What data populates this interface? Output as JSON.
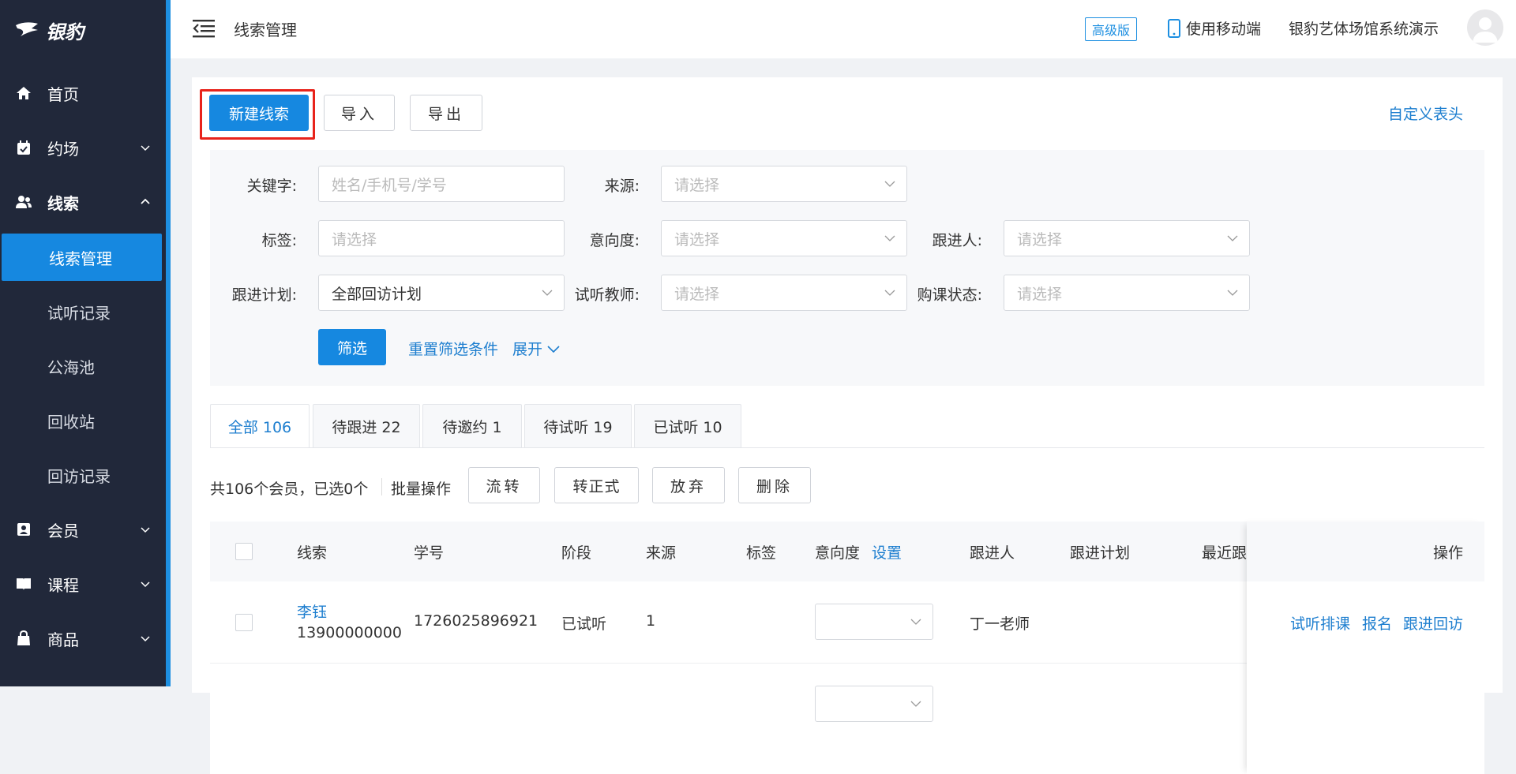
{
  "sidebar": {
    "logo_text": "银豹",
    "items": [
      {
        "label": "首页",
        "icon": "home-icon"
      },
      {
        "label": "约场",
        "icon": "calendar-check-icon"
      },
      {
        "label": "线索",
        "icon": "users-icon"
      },
      {
        "label": "会员",
        "icon": "member-card-icon"
      },
      {
        "label": "课程",
        "icon": "book-icon"
      },
      {
        "label": "商品",
        "icon": "bag-icon"
      }
    ],
    "sub_items": [
      "线索管理",
      "试听记录",
      "公海池",
      "回收站",
      "回访记录"
    ]
  },
  "topbar": {
    "breadcrumb": "线索管理",
    "edition_badge": "高级版",
    "mobile_label": "使用移动端",
    "org_name": "银豹艺体场馆系统演示"
  },
  "toolbar": {
    "new_lead": "新建线索",
    "import": "导入",
    "export": "导出",
    "custom_header": "自定义表头"
  },
  "filters": {
    "keyword_label": "关键字:",
    "keyword_placeholder": "姓名/手机号/学号",
    "source_label": "来源:",
    "tag_label": "标签:",
    "intent_label": "意向度:",
    "follower_label": "跟进人:",
    "plan_label": "跟进计划:",
    "plan_value": "全部回访计划",
    "teacher_label": "试听教师:",
    "purchase_label": "购课状态:",
    "select_placeholder": "请选择",
    "filter_button": "筛选",
    "reset_link": "重置筛选条件",
    "expand_link": "展开"
  },
  "tabs": [
    {
      "label": "全部 106"
    },
    {
      "label": "待跟进 22"
    },
    {
      "label": "待邀约 1"
    },
    {
      "label": "待试听 19"
    },
    {
      "label": "已试听 10"
    }
  ],
  "batch": {
    "summary": "共106个会员，已选0个",
    "label": "批量操作",
    "transfer": "流转",
    "to_formal": "转正式",
    "abandon": "放弃",
    "delete": "删除"
  },
  "table": {
    "headers": {
      "lead": "线索",
      "student_no": "学号",
      "stage": "阶段",
      "source": "来源",
      "tag": "标签",
      "intent": "意向度",
      "intent_setting": "设置",
      "follower": "跟进人",
      "plan": "跟进计划",
      "recent": "最近跟",
      "actions": "操作"
    },
    "rows": [
      {
        "name": "李钰",
        "phone": "13900000000",
        "student_no": "1726025896921",
        "stage": "已试听",
        "source": "1",
        "follower": "丁一老师",
        "actions": [
          "试听排课",
          "报名",
          "跟进回访"
        ]
      }
    ]
  },
  "colors": {
    "sidebar_bg": "#21283a",
    "accent": "#1688e0",
    "link": "#1d7ecf",
    "highlight_border": "#e8231b"
  }
}
